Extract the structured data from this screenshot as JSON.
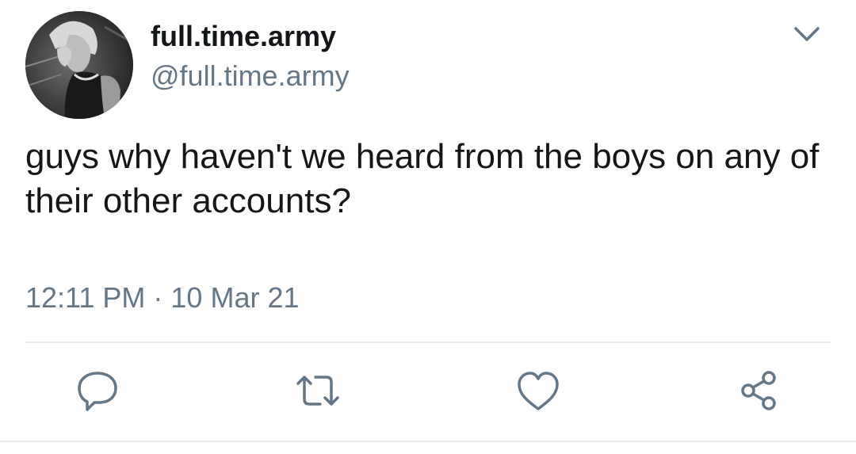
{
  "tweet": {
    "display_name": "full.time.army",
    "handle": "@full.time.army",
    "text": "guys why haven't we heard from the boys on any of their other accounts?",
    "timestamp": "12:11 PM · 10 Mar 21"
  },
  "icons": {
    "menu": "chevron-down-icon",
    "reply": "reply-icon",
    "retweet": "retweet-icon",
    "like": "heart-icon",
    "share": "share-icon"
  },
  "colors": {
    "text": "#14171a",
    "secondary": "#657786",
    "divider": "#e6ecf0"
  }
}
